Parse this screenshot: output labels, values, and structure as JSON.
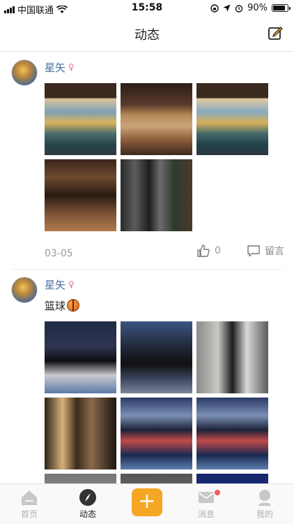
{
  "status_bar": {
    "carrier": "中国联通",
    "time": "15:58",
    "battery": "90%",
    "battery_level": 0.9
  },
  "navbar": {
    "title": "动态",
    "compose_icon": "edit-icon"
  },
  "posts": [
    {
      "author": "星矢",
      "gender_icon": "female-icon",
      "text": "",
      "images": [
        "cafe-mural-1",
        "cafe-interior",
        "cafe-mural-2",
        "cafe-bar",
        "cafe-neon"
      ],
      "date": "03-05",
      "like_count": "0",
      "comment_label": "留言"
    },
    {
      "author": "星矢",
      "gender_icon": "female-icon",
      "text": "篮球",
      "emoji_icon": "basketball-icon",
      "images": [
        "basketball-dribble",
        "basketball-dunk",
        "basketball-defense",
        "basketball-courtside",
        "basketball-crowd-1",
        "basketball-crowd-2",
        "partial-1",
        "partial-2",
        "partial-3"
      ]
    }
  ],
  "tabbar": {
    "items": [
      {
        "label": "首页",
        "icon": "home-icon"
      },
      {
        "label": "动态",
        "icon": "compass-icon",
        "active": true
      },
      {
        "label": "",
        "icon": "plus-icon"
      },
      {
        "label": "消息",
        "icon": "mail-icon",
        "badge": true
      },
      {
        "label": "我的",
        "icon": "profile-icon"
      }
    ]
  },
  "colors": {
    "accent": "#f5a623",
    "author_blue": "#4a6ea0",
    "badge_red": "#f15b5b"
  }
}
